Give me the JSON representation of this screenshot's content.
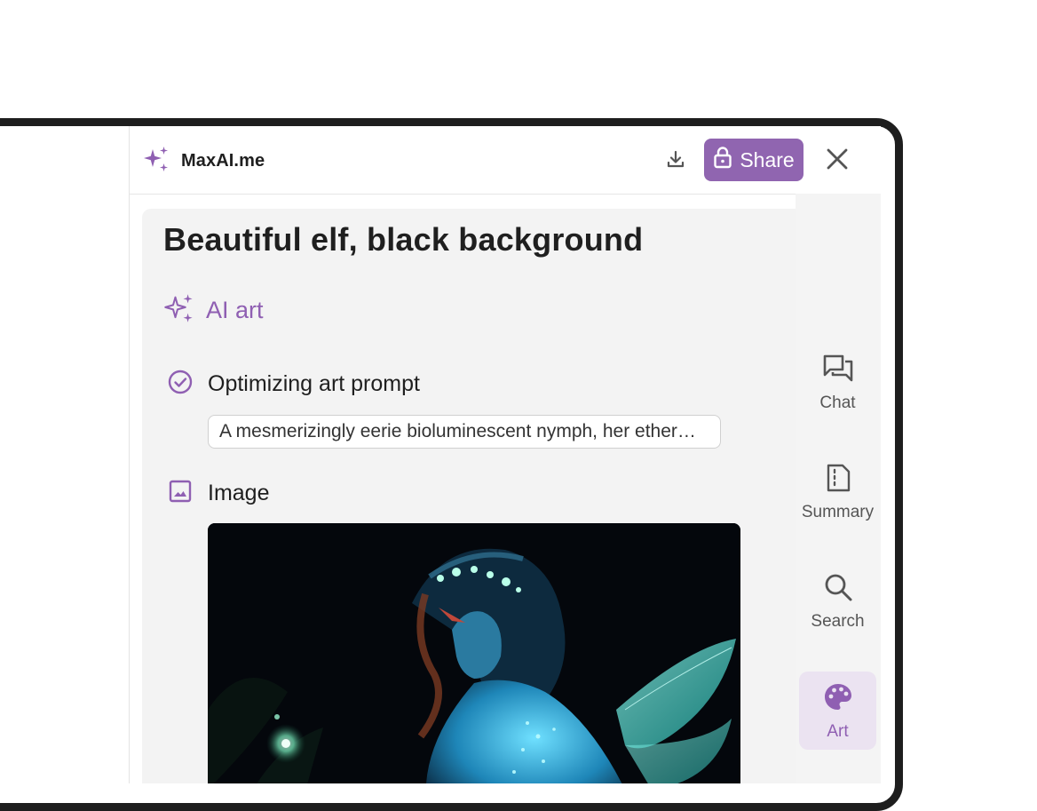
{
  "header": {
    "brand_name": "MaxAI.me",
    "share_label": "Share"
  },
  "message": {
    "title": "Beautiful elf, black background",
    "section_label": "AI art",
    "step_optimize_label": "Optimizing art prompt",
    "prompt_text": "A mesmerizingly eerie bioluminescent nymph, her ether…",
    "step_image_label": "Image"
  },
  "nav": {
    "items": [
      {
        "label": "Chat",
        "icon": "chat-icon"
      },
      {
        "label": "Summary",
        "icon": "summary-icon"
      },
      {
        "label": "Search",
        "icon": "search-icon"
      },
      {
        "label": "Art",
        "icon": "palette-icon",
        "active": true
      }
    ]
  },
  "colors": {
    "accent": "#9065b0",
    "accent_text": "#8f5fb2",
    "active_nav_bg": "#ebe3f1"
  }
}
